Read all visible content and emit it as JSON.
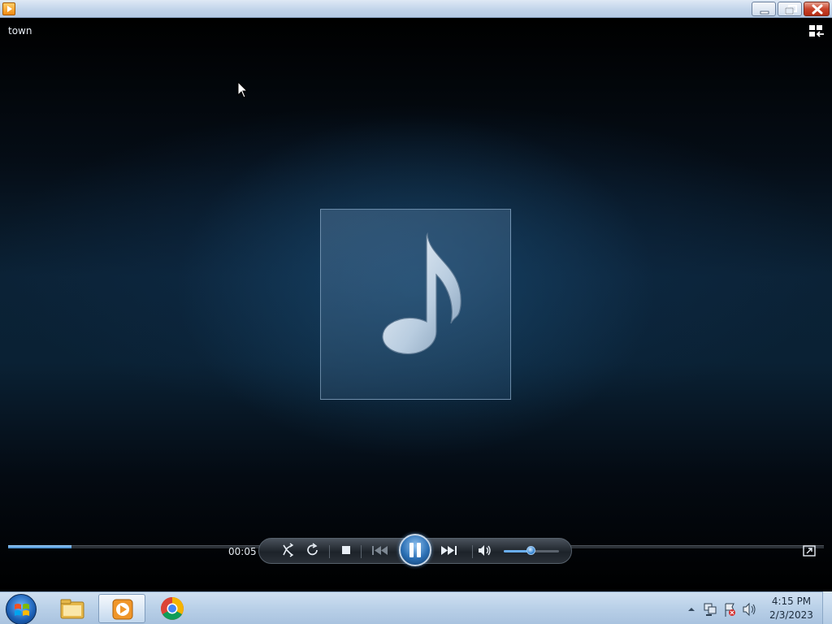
{
  "window": {
    "app_icon": "windows-media-player-icon",
    "buttons": [
      "minimize-icon",
      "restore-icon",
      "close-icon"
    ]
  },
  "now_playing": {
    "track_title": "town",
    "album_art_icon": "music-note-icon",
    "view_switch_icon": "switch-to-library-icon"
  },
  "playback": {
    "elapsed_time": "00:05",
    "seek_progress": 0.078,
    "volume_level": 0.48,
    "state": "playing",
    "accent_color": "#3d85c8"
  },
  "controls": [
    "shuffle-icon",
    "repeat-icon",
    "stop-icon",
    "previous-icon",
    "pause-icon",
    "next-icon",
    "volume-icon",
    "fullscreen-icon"
  ],
  "taskbar": {
    "pinned": [
      "windows-explorer-icon",
      "windows-media-player-icon",
      "chrome-icon"
    ],
    "clock": {
      "time": "4:15 PM",
      "date": "2/3/2023"
    },
    "tray_icons": [
      "show-hidden-icons-icon",
      "network-icon",
      "action-center-flag-icon",
      "speaker-icon"
    ]
  }
}
